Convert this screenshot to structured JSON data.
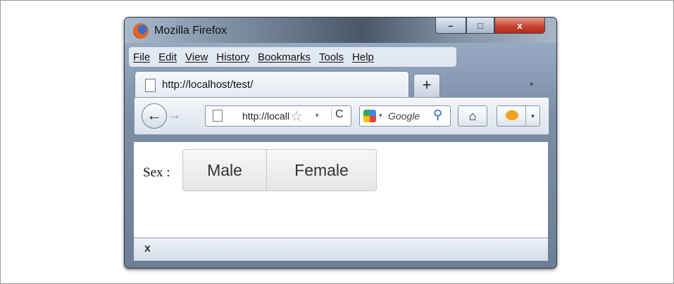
{
  "window": {
    "title": "Mozilla Firefox"
  },
  "window_controls": {
    "minimize": "–",
    "maximize": "□",
    "close": "x"
  },
  "menu": {
    "items": [
      "File",
      "Edit",
      "View",
      "History",
      "Bookmarks",
      "Tools",
      "Help"
    ]
  },
  "tab": {
    "label": "http://localhost/test/",
    "new_tab": "+",
    "tab_list": "▾"
  },
  "navbar": {
    "back": "←",
    "forward": "→",
    "url": "http://localhost/test/",
    "url_star": "☆",
    "url_drop": "▾",
    "reload": "C",
    "search_drop": "▾",
    "search_placeholder": "Google",
    "search_icon": "⚲",
    "home": "⌂",
    "addon_drop": "▾"
  },
  "content": {
    "sex_label": "Sex :",
    "options": [
      "Male",
      "Female"
    ]
  },
  "findbar": {
    "close": "x"
  },
  "icons": {
    "app": "firefox-icon",
    "page": "page-icon",
    "bookmark": "star-icon",
    "reload": "reload-icon",
    "search_engine": "google-icon",
    "search": "magnifier-icon",
    "home": "home-icon",
    "addon": "ladybug-icon"
  }
}
